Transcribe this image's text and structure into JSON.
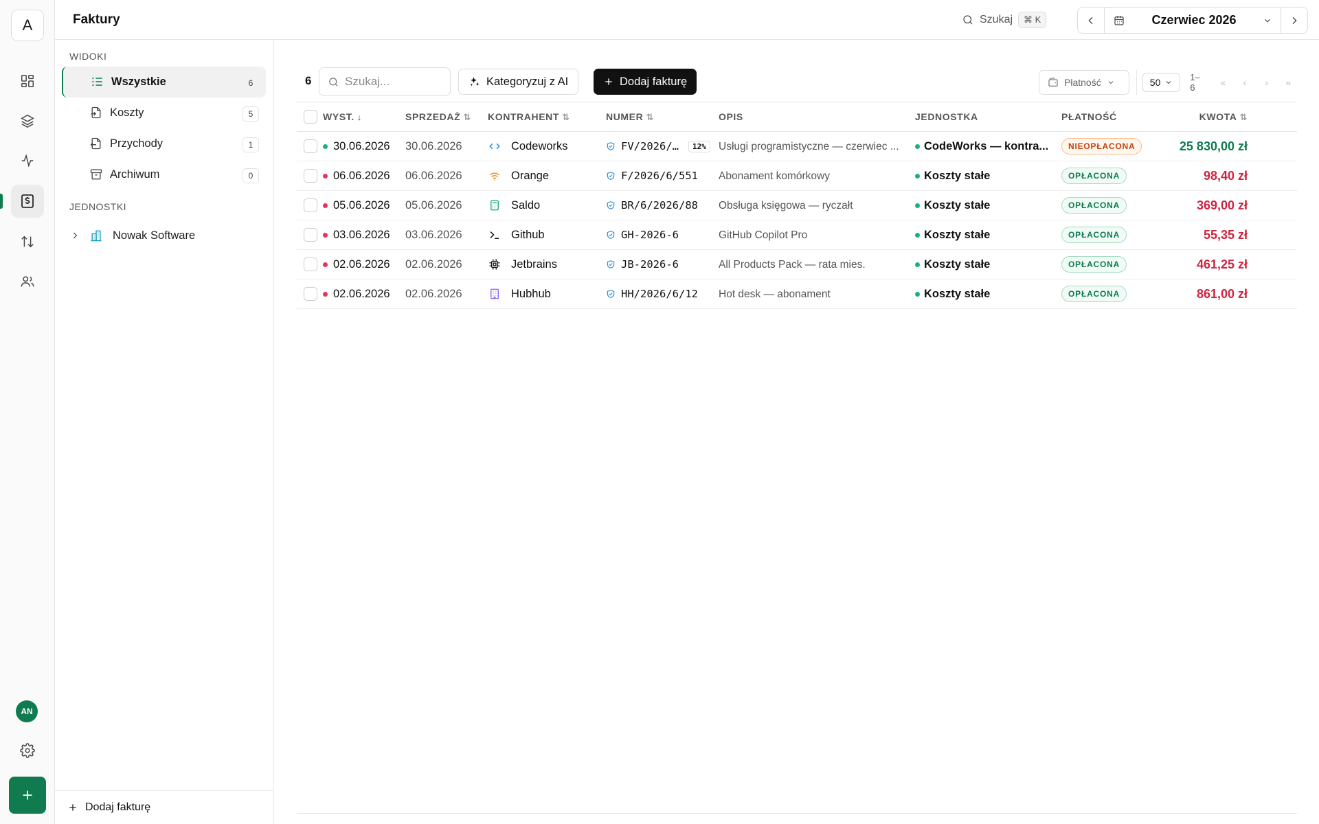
{
  "app": {
    "logo_letter": "A",
    "user_initials": "AN",
    "page_title": "Faktury",
    "accent_color": "#0f7b4f"
  },
  "header": {
    "search_label": "Szukaj",
    "search_shortcut": "⌘ K",
    "month": "Czerwiec 2026"
  },
  "sidebar": {
    "views_label": "WIDOKI",
    "views": [
      {
        "label": "Wszystkie",
        "count": "6",
        "icon": "list-icon",
        "active": true
      },
      {
        "label": "Koszty",
        "count": "5",
        "icon": "file-import-icon",
        "active": false
      },
      {
        "label": "Przychody",
        "count": "1",
        "icon": "file-export-icon",
        "active": false
      },
      {
        "label": "Archiwum",
        "count": "0",
        "icon": "archive-icon",
        "active": false
      }
    ],
    "units_label": "JEDNOSTKI",
    "units": [
      {
        "label": "Nowak Software",
        "icon": "building-icon"
      }
    ],
    "footer_add": "Dodaj fakturę"
  },
  "toolbar": {
    "total": "6",
    "search_placeholder": "Szukaj...",
    "ai_button": "Kategoryzuj z AI",
    "add_button": "Dodaj fakturę",
    "payment_filter": "Płatność",
    "per_page": "50",
    "range": "1–6"
  },
  "table": {
    "columns": {
      "issued": "WYST.",
      "sale": "SPRZEDAŻ",
      "vendor": "KONTRAHENT",
      "number": "NUMER",
      "description": "OPIS",
      "unit": "JEDNOSTKA",
      "payment": "PŁATNOŚĆ",
      "amount": "KWOTA"
    },
    "rows": [
      {
        "issued": "30.06.2026",
        "sale": "30.06.2026",
        "vendor": "Codeworks",
        "vendor_icon": "code-icon",
        "number": "FV/2026/…",
        "vat": "12%",
        "description": "Usługi programistyczne — czerwiec ...",
        "unit": "CodeWorks — kontra...",
        "payment": "NIEOPŁACONA",
        "amount": "25 830,00 zł",
        "type": "income"
      },
      {
        "issued": "06.06.2026",
        "sale": "06.06.2026",
        "vendor": "Orange",
        "vendor_icon": "wifi-icon",
        "number": "F/2026/6/551",
        "vat": "",
        "description": "Abonament komórkowy",
        "unit": "Koszty stałe",
        "payment": "OPŁACONA",
        "amount": "98,40 zł",
        "type": "cost"
      },
      {
        "issued": "05.06.2026",
        "sale": "05.06.2026",
        "vendor": "Saldo",
        "vendor_icon": "calculator-icon",
        "number": "BR/6/2026/88",
        "vat": "",
        "description": "Obsługa księgowa — ryczałt",
        "unit": "Koszty stałe",
        "payment": "OPŁACONA",
        "amount": "369,00 zł",
        "type": "cost"
      },
      {
        "issued": "03.06.2026",
        "sale": "03.06.2026",
        "vendor": "Github",
        "vendor_icon": "terminal-icon",
        "number": "GH-2026-6",
        "vat": "",
        "description": "GitHub Copilot Pro",
        "unit": "Koszty stałe",
        "payment": "OPŁACONA",
        "amount": "55,35 zł",
        "type": "cost"
      },
      {
        "issued": "02.06.2026",
        "sale": "02.06.2026",
        "vendor": "Jetbrains",
        "vendor_icon": "chip-icon",
        "number": "JB-2026-6",
        "vat": "",
        "description": "All Products Pack — rata mies.",
        "unit": "Koszty stałe",
        "payment": "OPŁACONA",
        "amount": "461,25 zł",
        "type": "cost"
      },
      {
        "issued": "02.06.2026",
        "sale": "02.06.2026",
        "vendor": "Hubhub",
        "vendor_icon": "office-building-icon",
        "number": "HH/2026/6/12",
        "vat": "",
        "description": "Hot desk — abonament",
        "unit": "Koszty stałe",
        "payment": "OPŁACONA",
        "amount": "861,00 zł",
        "type": "cost"
      }
    ]
  },
  "colors": {
    "income": "#0f7b4f",
    "cost": "#d0233f",
    "income_dot": "#19b37a",
    "cost_dot": "#e8335a",
    "unit_dot": "#19b37a",
    "unpaid_text": "#c2410c",
    "unpaid_border": "#fdba8c",
    "unpaid_bg": "#fff7ed",
    "paid_text": "#0f7b4f",
    "paid_border": "#a7dcc3",
    "paid_bg": "#f0fbf5"
  }
}
